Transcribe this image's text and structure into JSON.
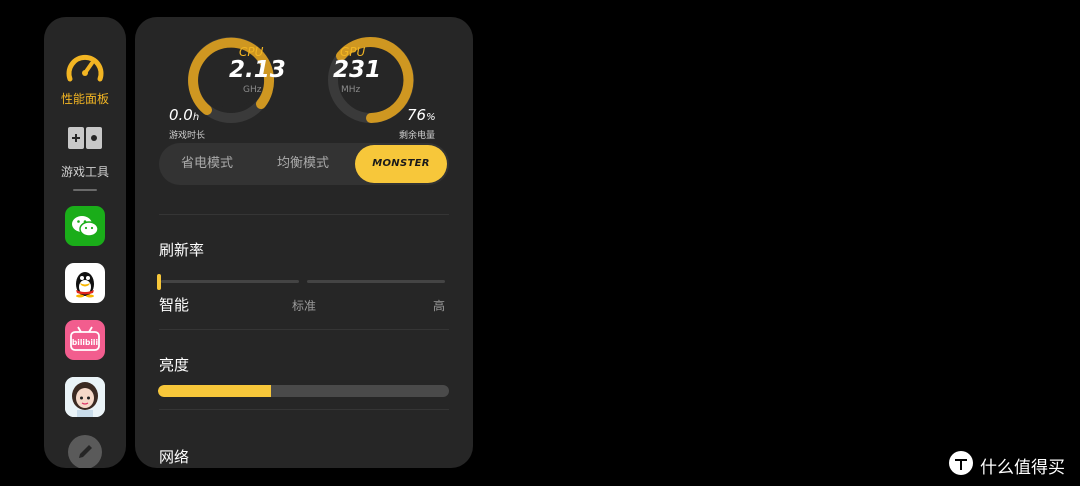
{
  "sidebar": {
    "perf_label": "性能面板",
    "tools_label": "游戏工具",
    "apps": [
      {
        "name": "WeChat",
        "color": "#1aad19"
      },
      {
        "name": "QQ",
        "color": "#ffffff"
      },
      {
        "name": "bilibili",
        "color": "#f25d8e",
        "logo_text": "bilibili"
      },
      {
        "name": "Avatar",
        "color": "#ffffff"
      }
    ]
  },
  "panel": {
    "cpu": {
      "label": "CPU",
      "value": "2.13",
      "unit": "GHz"
    },
    "gpu": {
      "label": "GPU",
      "value": "231",
      "unit": "MHz"
    },
    "game_time": {
      "value": "0.0",
      "unit": "h",
      "label": "游戏时长"
    },
    "battery": {
      "value": "76",
      "unit": "%",
      "label": "剩余电量"
    },
    "modes": [
      "省电模式",
      "均衡模式",
      "MONSTER"
    ],
    "active_mode": "MONSTER",
    "refresh_rate": {
      "title": "刷新率",
      "options": [
        "智能",
        "标准",
        "高"
      ],
      "selected": "智能"
    },
    "brightness": {
      "title": "亮度",
      "level": 0.39
    },
    "network": {
      "title": "网络"
    }
  },
  "colors": {
    "accent": "#f7c73a",
    "panel_bg": "#262626",
    "page_bg": "#000000"
  },
  "watermark": {
    "text": "什么值得买"
  }
}
